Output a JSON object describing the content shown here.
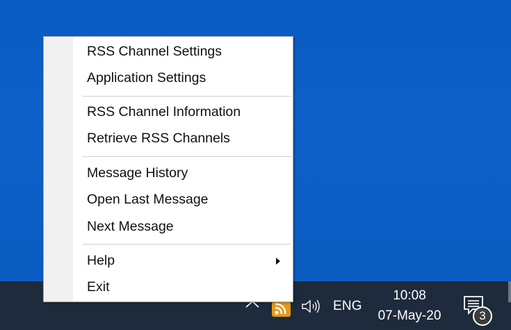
{
  "context_menu": {
    "groups": [
      {
        "items": [
          {
            "label": "RSS Channel Settings"
          },
          {
            "label": "Application Settings"
          }
        ]
      },
      {
        "items": [
          {
            "label": "RSS Channel Information"
          },
          {
            "label": "Retrieve RSS Channels"
          }
        ]
      },
      {
        "items": [
          {
            "label": "Message History"
          },
          {
            "label": "Open Last Message"
          },
          {
            "label": "Next Message"
          }
        ]
      },
      {
        "items": [
          {
            "label": "Help",
            "has_submenu": true
          },
          {
            "label": "Exit"
          }
        ]
      }
    ]
  },
  "taskbar": {
    "tray_icons": [
      "chevron-up-icon",
      "rss-feed-icon",
      "speaker-volume-icon"
    ],
    "language": "ENG",
    "clock": {
      "time": "10:08",
      "date": "07-May-20"
    },
    "notifications": {
      "icon": "action-center-icon",
      "count": "3"
    }
  },
  "colors": {
    "desktop_blue": "#0c61c8",
    "taskbar": "#1e2b3c",
    "rss_orange": "#e59a1b",
    "menu_background": "#ffffff",
    "menu_gutter": "#f1f1f1"
  }
}
